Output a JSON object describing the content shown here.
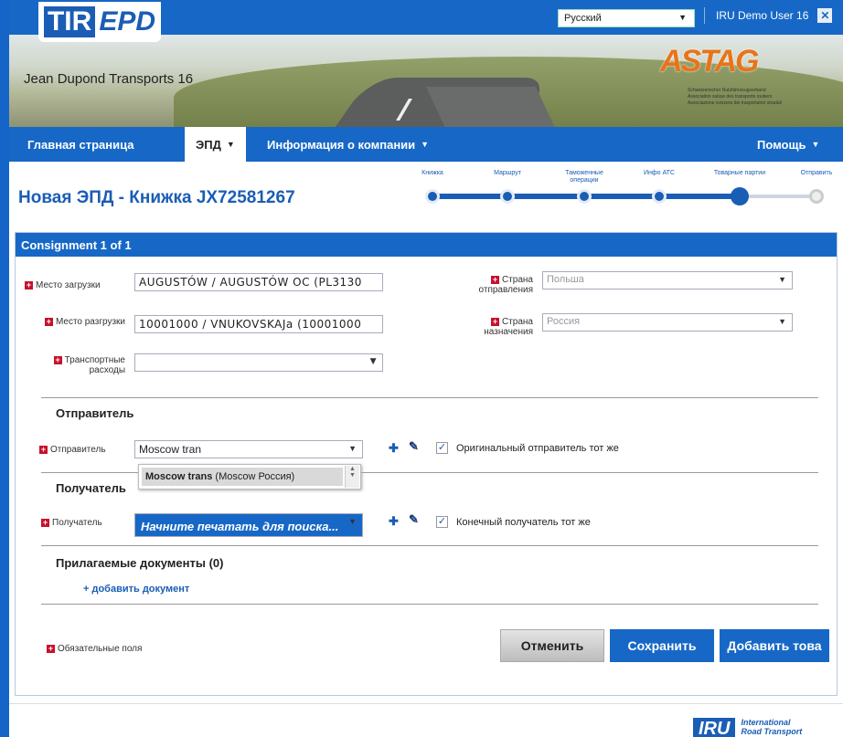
{
  "header": {
    "logo_tir": "TIR",
    "logo_epd": "EPD",
    "company": "Jean Dupond Transports 16",
    "language": "Русский",
    "user": "IRU Demo User 16",
    "astag_mark": "ASTAG",
    "astag_line1": "Schweizerischer Nutzfahrzeugverband",
    "astag_line2": "Association suisse des transports routiers",
    "astag_line3": "Associazione svizzera dei trasportatori stradali"
  },
  "nav": {
    "home": "Главная страница",
    "epd": "ЭПД",
    "company_info": "Информация о компании",
    "help": "Помощь"
  },
  "page": {
    "title": "Новая ЭПД - Книжка JX72581267"
  },
  "progress": {
    "steps": [
      "Книжка",
      "Маршрут",
      "Таможенные операции",
      "Инфо АТС",
      "Товарные партии",
      "Отправить"
    ],
    "current_step": 5
  },
  "panel": {
    "header": "Consignment 1 of 1",
    "loading_place_label": "Место загрузки",
    "loading_place_value": "AUGUSTÓW / AUGUSTÓW OC (PL3130",
    "departure_country_label": "Страна отправления",
    "departure_country_value": "Польша",
    "unloading_place_label": "Место разгрузки",
    "unloading_place_value": "10001000 / VNUKOVSKAJa (10001000",
    "destination_country_label": "Страна назначения",
    "destination_country_value": "Россия",
    "transport_costs_label": "Транспортные расходы",
    "transport_costs_value": "",
    "sender_section": "Отправитель",
    "sender_label": "Отправитель",
    "sender_value": "Moscow tran",
    "sender_same_label": "Оригинальный отправитель тот же",
    "sender_option_bold": "Moscow trans",
    "sender_option_rest": " (Moscow Россия)",
    "receiver_section": "Получатель",
    "receiver_label": "Получатель",
    "receiver_placeholder": "Начните печатать для поиска...",
    "receiver_same_label": "Конечный получатель тот же",
    "docs_section": "Прилагаемые документы (0)",
    "add_doc": "+ добавить документ",
    "required_fields": "Обязательные поля"
  },
  "buttons": {
    "cancel": "Отменить",
    "save": "Сохранить",
    "add_goods": "Добавить това"
  },
  "footer": {
    "iru": "IRU",
    "iru_line1": "International",
    "iru_line2": "Road Transport"
  },
  "colors": {
    "brand_blue": "#1768c6",
    "required_red": "#c8102e"
  }
}
